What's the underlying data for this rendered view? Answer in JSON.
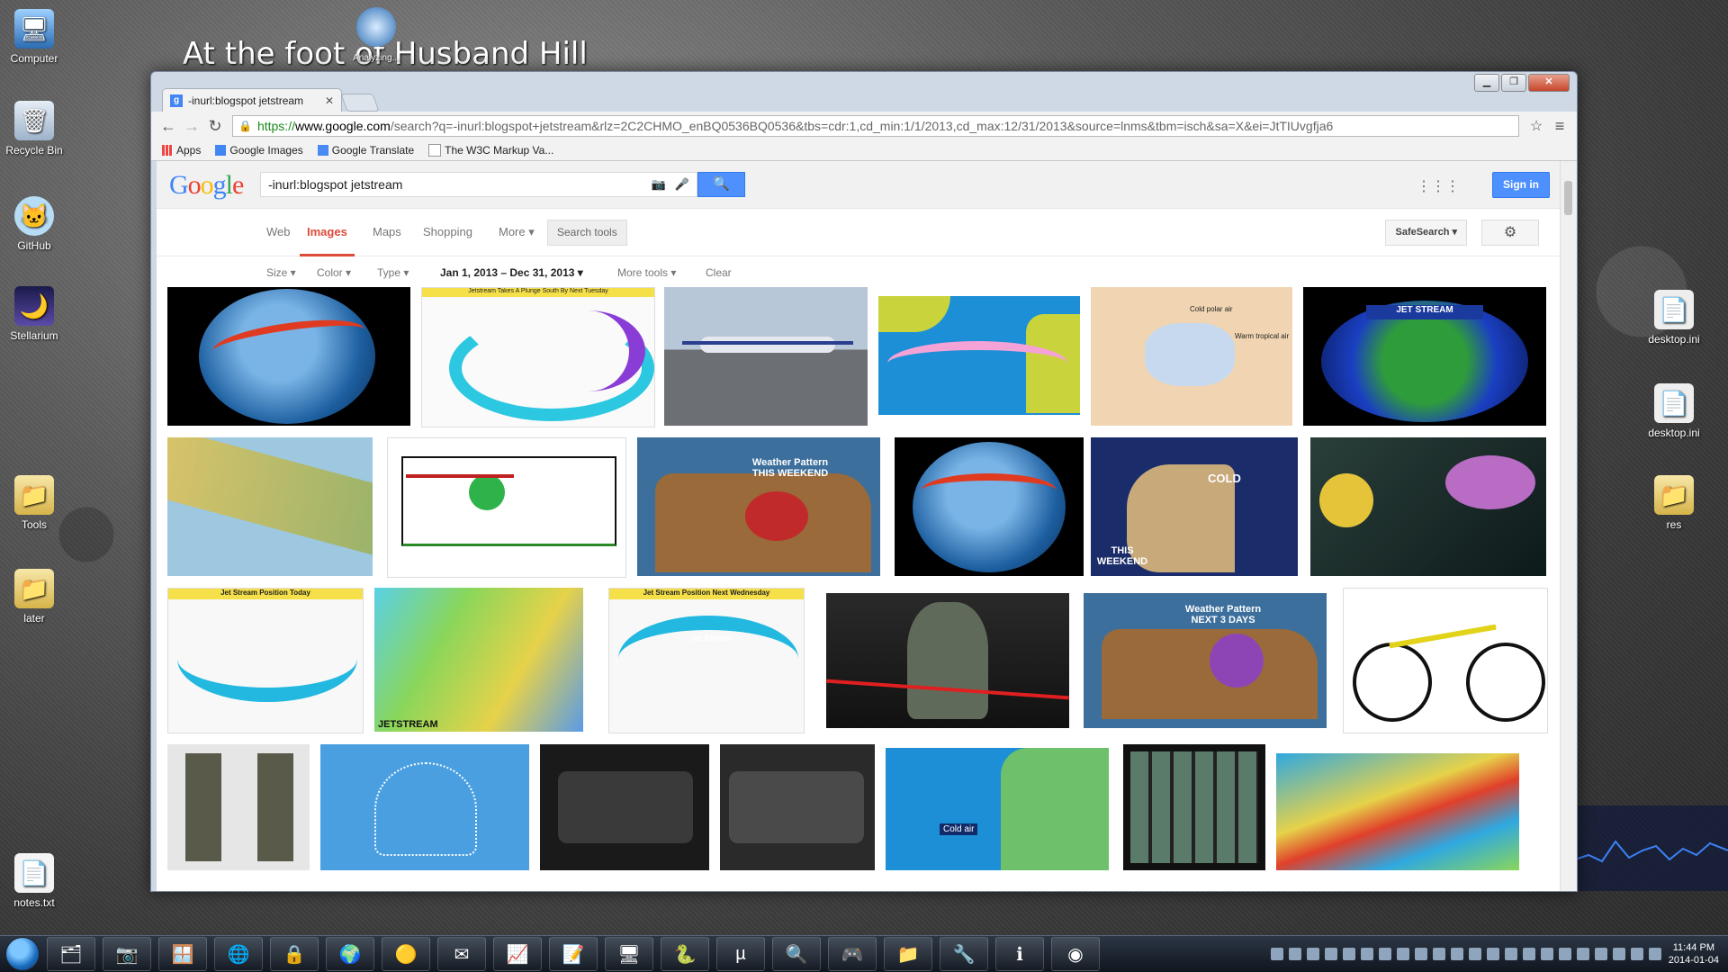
{
  "desktop": {
    "caption": "At the foot of Husband Hill",
    "icons_left": [
      {
        "label": "Computer",
        "icon": "computer-icon"
      },
      {
        "label": "Recycle Bin",
        "icon": "recycle-bin-icon"
      },
      {
        "label": "GitHub",
        "icon": "github-icon"
      },
      {
        "label": "Stellarium",
        "icon": "stellarium-icon"
      },
      {
        "label": "Tools",
        "icon": "folder-icon"
      },
      {
        "label": "later",
        "icon": "folder-icon"
      },
      {
        "label": "notes.txt",
        "icon": "text-file-icon"
      }
    ],
    "icons_right": [
      {
        "label": "desktop.ini",
        "icon": "ini-file-icon"
      },
      {
        "label": "desktop.ini",
        "icon": "ini-file-icon"
      },
      {
        "label": "res",
        "icon": "folder-icon"
      }
    ],
    "top_icon_label": "Analyzing..."
  },
  "browser": {
    "tab_title": "-inurl:blogspot jetstream",
    "url_https": "https://",
    "url_host": "www.google.com",
    "url_rest": "/search?q=-inurl:blogspot+jetstream&rlz=2C2CHMO_enBQ0536BQ0536&tbs=cdr:1,cd_min:1/1/2013,cd_max:12/31/2013&source=lnms&tbm=isch&sa=X&ei=JtTIUvgfja6",
    "bookmarks": [
      "Apps",
      "Google Images",
      "Google Translate",
      "The W3C Markup Va..."
    ]
  },
  "google": {
    "logo": "Google",
    "query": "-inurl:blogspot jetstream",
    "sign_in": "Sign in",
    "tabs": [
      "Web",
      "Images",
      "Maps",
      "Shopping",
      "More ▾"
    ],
    "search_tools": "Search tools",
    "safe_search": "SafeSearch ▾",
    "filters": [
      "Size ▾",
      "Color ▾",
      "Type ▾",
      "Jan 1, 2013 – Dec 31, 2013 ▾",
      "More tools ▾",
      "Clear"
    ]
  },
  "results": {
    "labels": {
      "jet_title_1": "Jetstream Takes A Plunge South By Next Tuesday",
      "jet_stream_banner": "JET STREAM",
      "weather_pattern_1": "Weather Pattern THIS WEEKEND",
      "cold": "COLD",
      "this_weekend": "THIS WEEKEND",
      "jet_today": "Jet Stream Position Today",
      "jet_next": "Jet Stream Position Next Wednesday",
      "jetstream": "JETSTREAM",
      "weather_pattern_2": "Weather Pattern NEXT 3 DAYS",
      "cold_air": "Cold air",
      "cold_polar_air": "Cold polar air",
      "warm_tropical_air": "Warm tropical air",
      "jet_stream_small": "Jet Stream"
    }
  },
  "taskbar": {
    "time": "11:44 PM",
    "date": "2014-01-04"
  }
}
